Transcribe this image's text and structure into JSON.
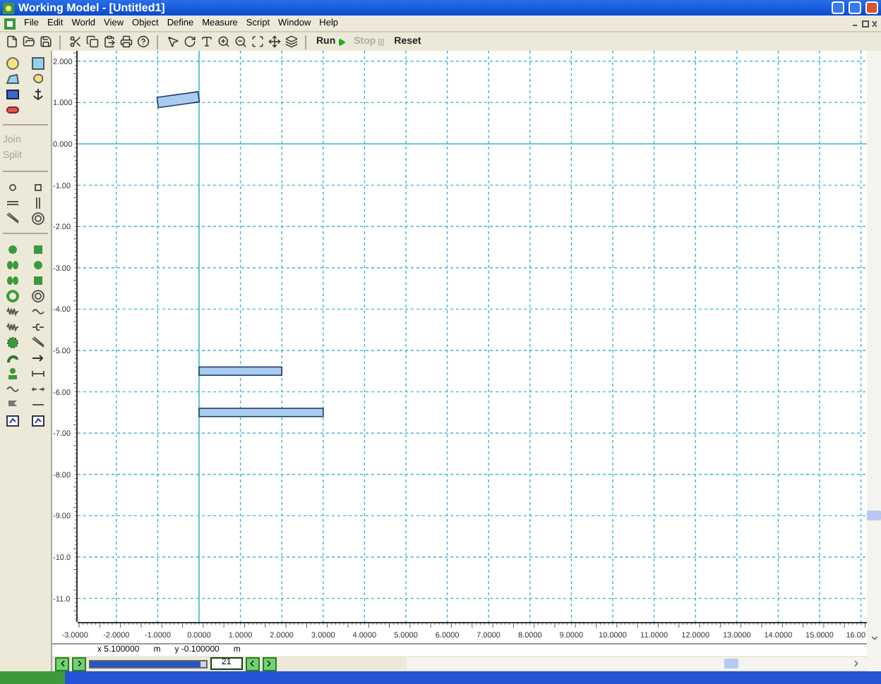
{
  "window": {
    "title": "Working Model - [Untitled1]"
  },
  "menu": [
    "File",
    "Edit",
    "World",
    "View",
    "Object",
    "Define",
    "Measure",
    "Script",
    "Window",
    "Help"
  ],
  "run_controls": [
    {
      "label": "Run",
      "disabled": false,
      "kind": "run"
    },
    {
      "label": "Stop",
      "disabled": true,
      "kind": "stop"
    },
    {
      "label": "Reset",
      "disabled": false,
      "kind": "reset"
    }
  ],
  "palette_actions": [
    {
      "label": "Join",
      "disabled": true
    },
    {
      "label": "Split",
      "disabled": true
    }
  ],
  "y_ruler_labels": [
    "2.000",
    "1.000",
    "0.000",
    "-1.00",
    "-2.00",
    "-3.00",
    "-4.00",
    "-5.00",
    "-6.00",
    "-7.00",
    "-8.00",
    "-9.00",
    "-10.0",
    "-11.0"
  ],
  "x_ruler_labels": [
    "-3.0000",
    "-2.0000",
    "-1.0000",
    "0.0000",
    "1.0000",
    "2.0000",
    "3.0000",
    "4.0000",
    "5.0000",
    "6.0000",
    "7.0000",
    "8.0000",
    "9.0000",
    "10.0000",
    "11.0000",
    "12.0000",
    "13.0000",
    "14.0000",
    "15.0000",
    "16.00"
  ],
  "bodies": [
    {
      "kind": "rectangle"
    },
    {
      "kind": "rectangle"
    },
    {
      "kind": "rectangle"
    }
  ],
  "coordinates": {
    "x": "x 5.100000",
    "x_unit": "m",
    "y": "y -0.100000",
    "y_unit": "m"
  },
  "frame_counter": {
    "value": "21",
    "level": 0.95
  }
}
